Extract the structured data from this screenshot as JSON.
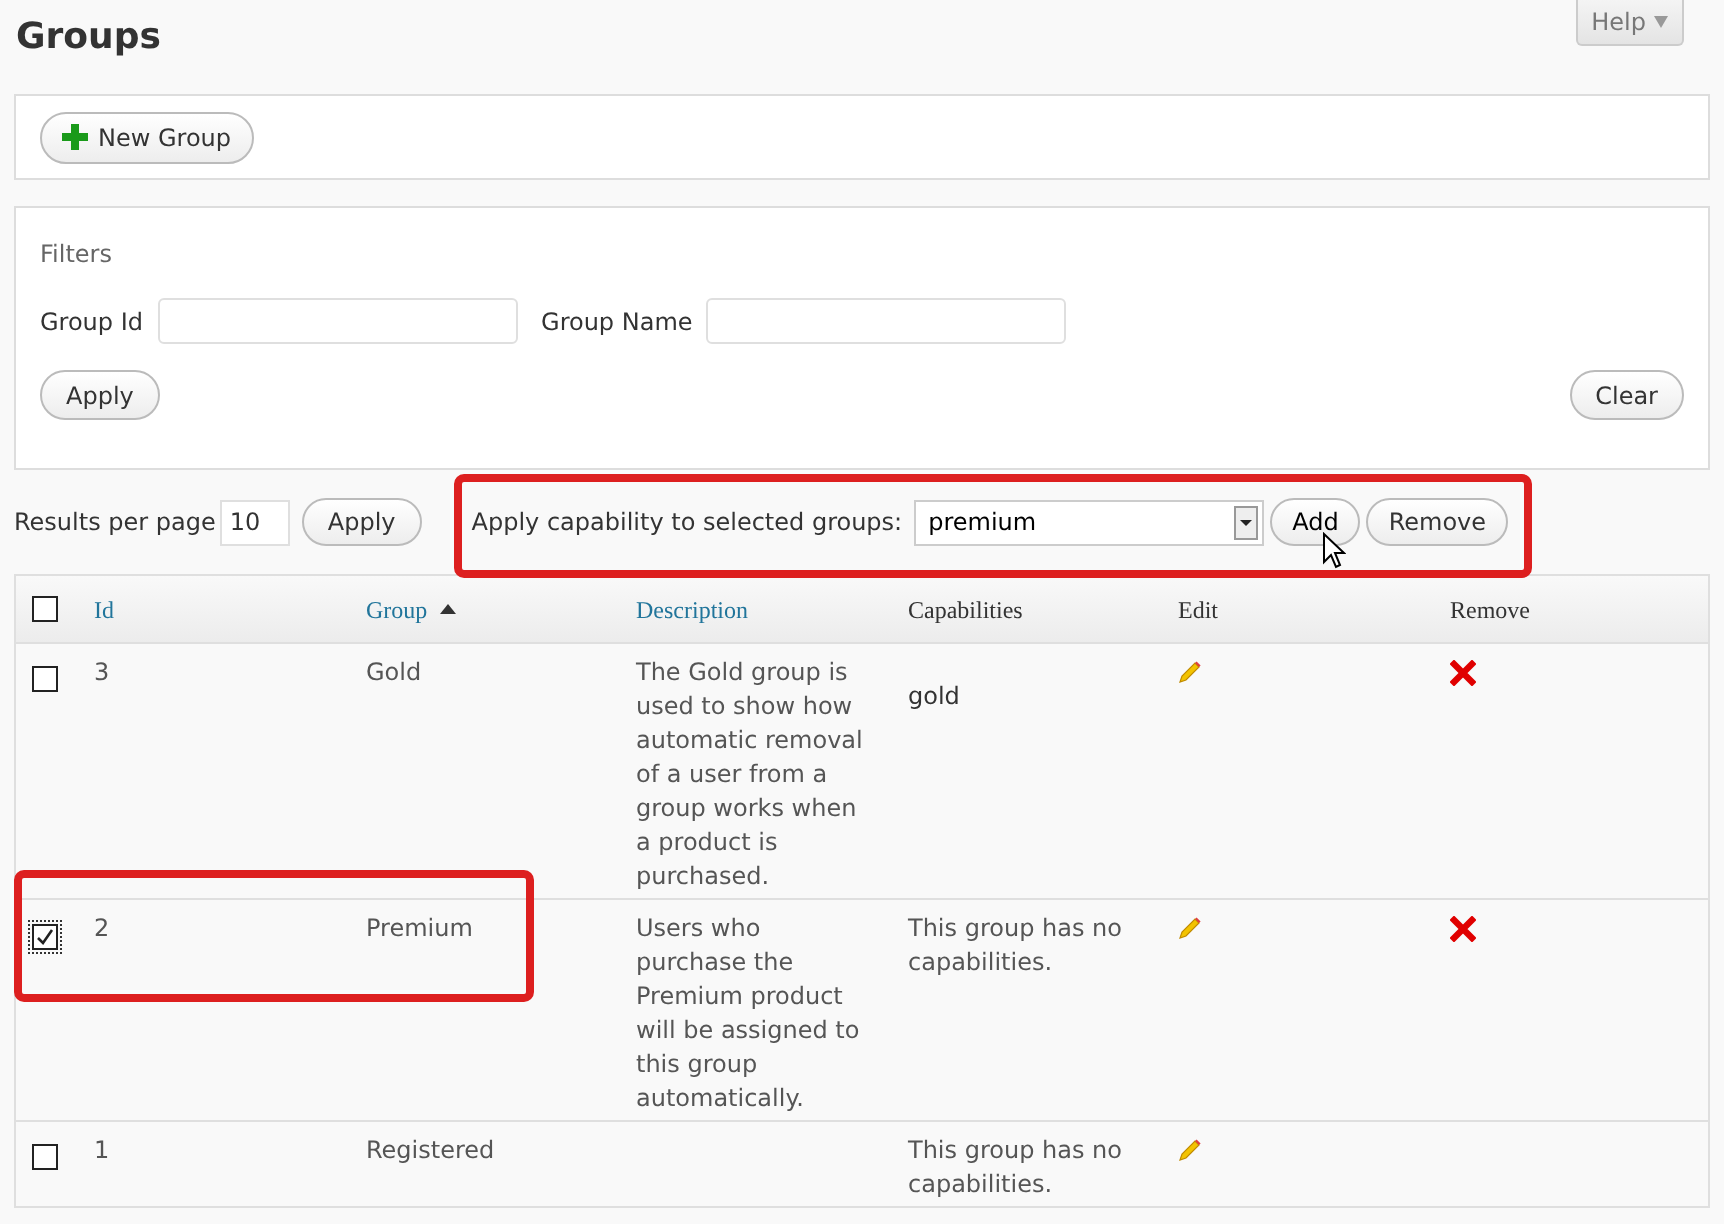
{
  "help_tab": {
    "label": "Help"
  },
  "title": "Groups",
  "new_group_button": {
    "label": "New Group"
  },
  "filters": {
    "heading": "Filters",
    "fields": [
      {
        "label": "Group Id"
      },
      {
        "label": "Group Name"
      }
    ],
    "apply_button": "Apply",
    "clear_button": "Clear"
  },
  "pagination": {
    "label": "Results per page",
    "value": "10",
    "apply_button": "Apply"
  },
  "capability_bar": {
    "label": "Apply capability to selected groups:",
    "selected_capability": "premium",
    "add_button": "Add",
    "remove_button": "Remove",
    "highlighted": true
  },
  "table": {
    "select_all_checked": false,
    "columns": [
      {
        "label": "Id",
        "sortable": true,
        "sorted": false
      },
      {
        "label": "Group",
        "sortable": true,
        "sorted": true
      },
      {
        "label": "Description",
        "sortable": true,
        "sorted": false
      },
      {
        "label": "Capabilities",
        "sortable": false,
        "sorted": false
      },
      {
        "label": "Edit",
        "sortable": false,
        "sorted": false
      },
      {
        "label": "Remove",
        "sortable": false,
        "sorted": false
      }
    ],
    "rows": [
      {
        "checked": false,
        "highlighted": false,
        "id": "3",
        "group": "Gold",
        "description": "The Gold group is used to show how automatic removal of a user from a group works when a product is purchased.",
        "capabilities": "gold",
        "kind": "list",
        "removable": true
      },
      {
        "checked": true,
        "highlighted": true,
        "id": "2",
        "group": "Premium",
        "description": "Users who purchase the Premium product will be assigned to this group automatically.",
        "capabilities": "This group has no capabilities.",
        "kind": "note",
        "removable": true
      },
      {
        "checked": false,
        "highlighted": false,
        "id": "1",
        "group": "Registered",
        "capabilities": "This group has no capabilities.",
        "kind": "note",
        "removable": false
      }
    ]
  }
}
